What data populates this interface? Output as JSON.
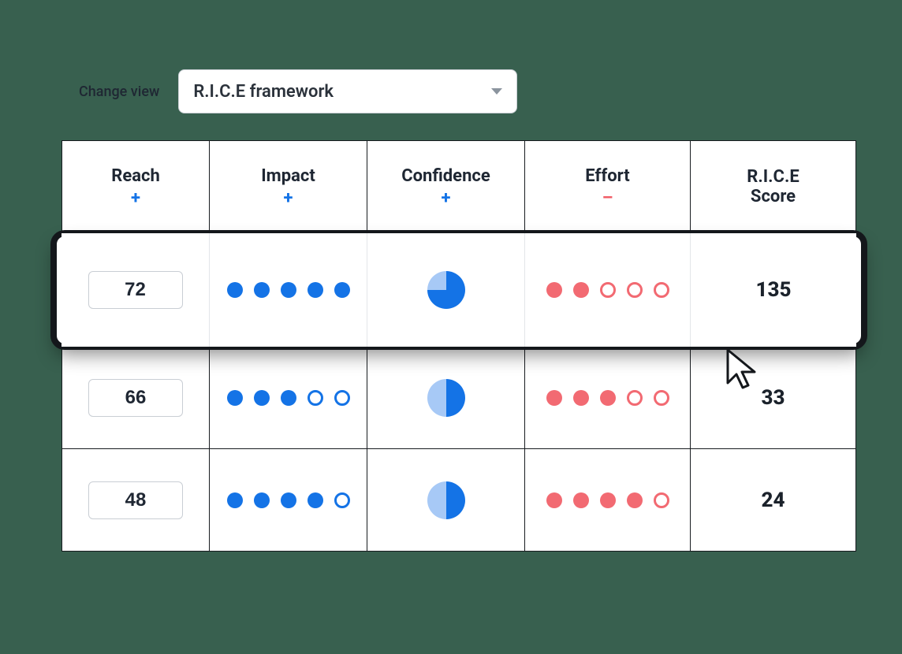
{
  "controls": {
    "change_view_label": "Change view",
    "selected_view": "R.I.C.E framework"
  },
  "columns": [
    {
      "title": "Reach",
      "sign": "+"
    },
    {
      "title": "Impact",
      "sign": "+"
    },
    {
      "title": "Confidence",
      "sign": "+"
    },
    {
      "title": "Effort",
      "sign": "-"
    },
    {
      "title": "R.I.C.E Score",
      "sign": ""
    }
  ],
  "colors": {
    "impact_fill": "#1473e6",
    "effort_fill": "#f26a72",
    "confidence_fill": "#1473e6",
    "confidence_rest": "#a7c9f6"
  },
  "rows": [
    {
      "reach": "72",
      "impact_filled": 5,
      "impact_total": 5,
      "confidence_pct": 75,
      "effort_filled": 2,
      "effort_total": 5,
      "score": "135",
      "highlight": true
    },
    {
      "reach": "66",
      "impact_filled": 3,
      "impact_total": 5,
      "confidence_pct": 50,
      "effort_filled": 3,
      "effort_total": 5,
      "score": "33",
      "highlight": false
    },
    {
      "reach": "48",
      "impact_filled": 4,
      "impact_total": 5,
      "confidence_pct": 50,
      "effort_filled": 4,
      "effort_total": 5,
      "score": "24",
      "highlight": false
    }
  ]
}
